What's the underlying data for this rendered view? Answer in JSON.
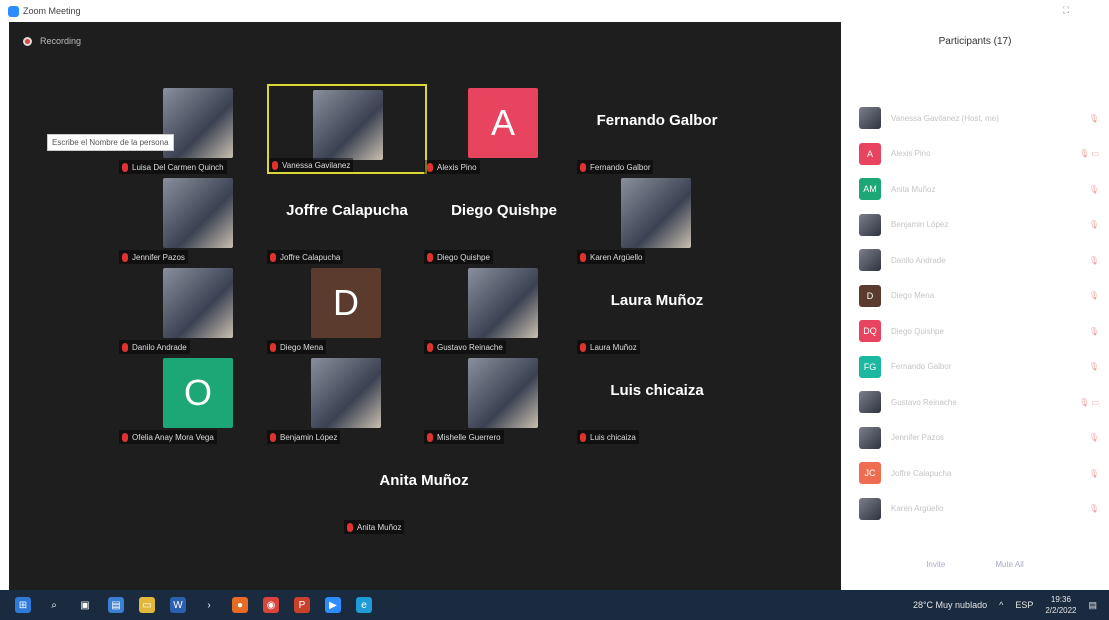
{
  "window": {
    "title": "Zoom Meeting"
  },
  "recording": {
    "label": "Recording"
  },
  "tooltip": {
    "text": "Escribe el Nombre de la persona"
  },
  "gallery": {
    "tiles": [
      {
        "name": "Luisa Del Carmen Quinch",
        "kind": "photo"
      },
      {
        "name": "Vanessa Gavilanez",
        "kind": "photo",
        "active": true
      },
      {
        "name": "Alexis Pino",
        "kind": "letter",
        "letter": "A",
        "color": "#e8435f"
      },
      {
        "name": "Fernando Galbor",
        "kind": "text",
        "big": "Fernando Galbor"
      },
      {
        "name": "Jennifer Pazos",
        "kind": "photo"
      },
      {
        "name": "Joffre Calapucha",
        "kind": "text",
        "big": "Joffre Calapucha"
      },
      {
        "name": "Diego Quishpe",
        "kind": "text",
        "big": "Diego Quishpe"
      },
      {
        "name": "Karen Argüello",
        "kind": "photo"
      },
      {
        "name": "Danilo Andrade",
        "kind": "photo"
      },
      {
        "name": "Diego Mena",
        "kind": "letter",
        "letter": "D",
        "color": "#5a3b2e"
      },
      {
        "name": "Gustavo Reinache",
        "kind": "photo"
      },
      {
        "name": "Laura Muñoz",
        "kind": "text",
        "big": "Laura Muñoz"
      },
      {
        "name": "Ofelia Anay Mora Vega",
        "kind": "letter",
        "letter": "O",
        "color": "#1da676"
      },
      {
        "name": "Benjamin López",
        "kind": "photo"
      },
      {
        "name": "Mishelle Guerrero",
        "kind": "photo"
      },
      {
        "name": "Luis chicaiza",
        "kind": "text",
        "big": "Luis chicaiza"
      },
      {
        "name": "Anita Muñoz",
        "kind": "text",
        "big": "Anita Muñoz"
      }
    ]
  },
  "participants": {
    "title": "Participants (17)",
    "items": [
      {
        "initials": "",
        "name": "Vanessa Gavilanez (Host, me)",
        "color": "#2d4a7a",
        "icons": "🎙"
      },
      {
        "initials": "A",
        "name": "Alexis Pino",
        "color": "#e8435f",
        "icons": "🎙 ▭"
      },
      {
        "initials": "AM",
        "name": "Anita Muñoz",
        "color": "#1da676",
        "icons": "🎙"
      },
      {
        "initials": "",
        "name": "Benjamin López",
        "color": "",
        "icons": "🎙"
      },
      {
        "initials": "",
        "name": "Danilo Andrade",
        "color": "",
        "icons": "🎙"
      },
      {
        "initials": "D",
        "name": "Diego Mena",
        "color": "#5a3b2e",
        "icons": "🎙"
      },
      {
        "initials": "DQ",
        "name": "Diego Quishpe",
        "color": "#e8435f",
        "icons": "🎙"
      },
      {
        "initials": "FG",
        "name": "Fernando Galbor",
        "color": "#1db8a0",
        "icons": "🎙"
      },
      {
        "initials": "",
        "name": "Gustavo Reinache",
        "color": "",
        "icons": "🎙 ▭"
      },
      {
        "initials": "",
        "name": "Jennifer Pazos",
        "color": "",
        "icons": "🎙"
      },
      {
        "initials": "JC",
        "name": "Joffre Calapucha",
        "color": "#f06c50",
        "icons": "🎙"
      },
      {
        "initials": "",
        "name": "Karen Argüello",
        "color": "",
        "icons": "🎙"
      }
    ],
    "footer": {
      "invite": "Invite",
      "mute_all": "Mute All"
    }
  },
  "taskbar": {
    "icons": [
      {
        "name": "windows-start-icon",
        "glyph": "⊞",
        "color": "#2d7ad8"
      },
      {
        "name": "search-icon",
        "glyph": "⌕",
        "color": "transparent"
      },
      {
        "name": "task-view-icon",
        "glyph": "▣",
        "color": "transparent"
      },
      {
        "name": "store-icon",
        "glyph": "▤",
        "color": "#3b7fd4"
      },
      {
        "name": "file-explorer-icon",
        "glyph": "▭",
        "color": "#e2b83a"
      },
      {
        "name": "word-icon",
        "glyph": "W",
        "color": "#2b5fb0"
      },
      {
        "name": "arrow-app-icon",
        "glyph": "›",
        "color": "transparent"
      },
      {
        "name": "firefox-icon",
        "glyph": "●",
        "color": "#e66b25"
      },
      {
        "name": "chrome-icon",
        "glyph": "◉",
        "color": "#d8443a"
      },
      {
        "name": "powerpoint-icon",
        "glyph": "P",
        "color": "#c8412b"
      },
      {
        "name": "zoom-icon",
        "glyph": "▶",
        "color": "#2d8cff"
      },
      {
        "name": "edge-icon",
        "glyph": "e",
        "color": "#1f9cd6"
      }
    ],
    "weather": "28°C  Muy nublado",
    "lang": "ESP",
    "time": "19:36",
    "date": "2/2/2022"
  }
}
